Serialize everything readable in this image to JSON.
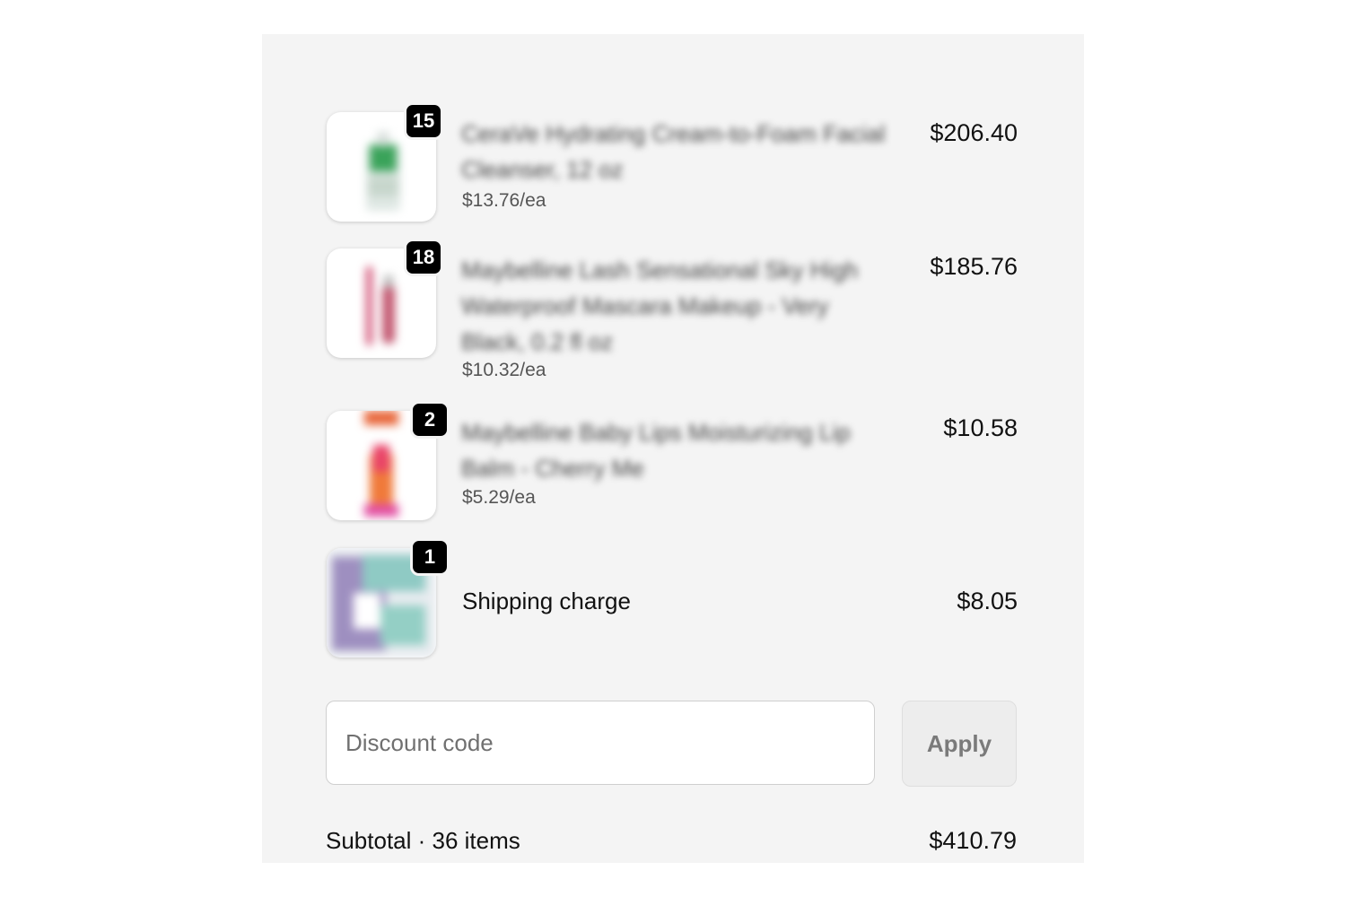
{
  "items": [
    {
      "quantity": "15",
      "name": "CeraVe Hydrating Cream-to-Foam Facial Cleanser, 12 oz",
      "unit_price": "$13.76/ea",
      "total": "$206.40",
      "thumb_icon": "cleanser-bottle-image"
    },
    {
      "quantity": "18",
      "name": "Maybelline Lash Sensational Sky High Waterproof Mascara Makeup - Very Black, 0.2 fl oz",
      "unit_price": "$10.32/ea",
      "total": "$185.76",
      "thumb_icon": "mascara-image"
    },
    {
      "quantity": "2",
      "name": "Maybelline Baby Lips Moisturizing Lip Balm - Cherry Me",
      "unit_price": "$5.29/ea",
      "total": "$10.58",
      "thumb_icon": "lip-balm-image"
    }
  ],
  "shipping": {
    "quantity": "1",
    "label": "Shipping charge",
    "total": "$8.05",
    "thumb_icon": "shipping-box-image"
  },
  "discount": {
    "placeholder": "Discount code",
    "value": "",
    "apply_label": "Apply"
  },
  "subtotal": {
    "label": "Subtotal · 36 items",
    "value": "$410.79"
  },
  "colors": {
    "panel_bg": "#f4f4f4",
    "badge_bg": "#000000",
    "badge_text": "#ffffff",
    "apply_bg": "#ededed"
  }
}
